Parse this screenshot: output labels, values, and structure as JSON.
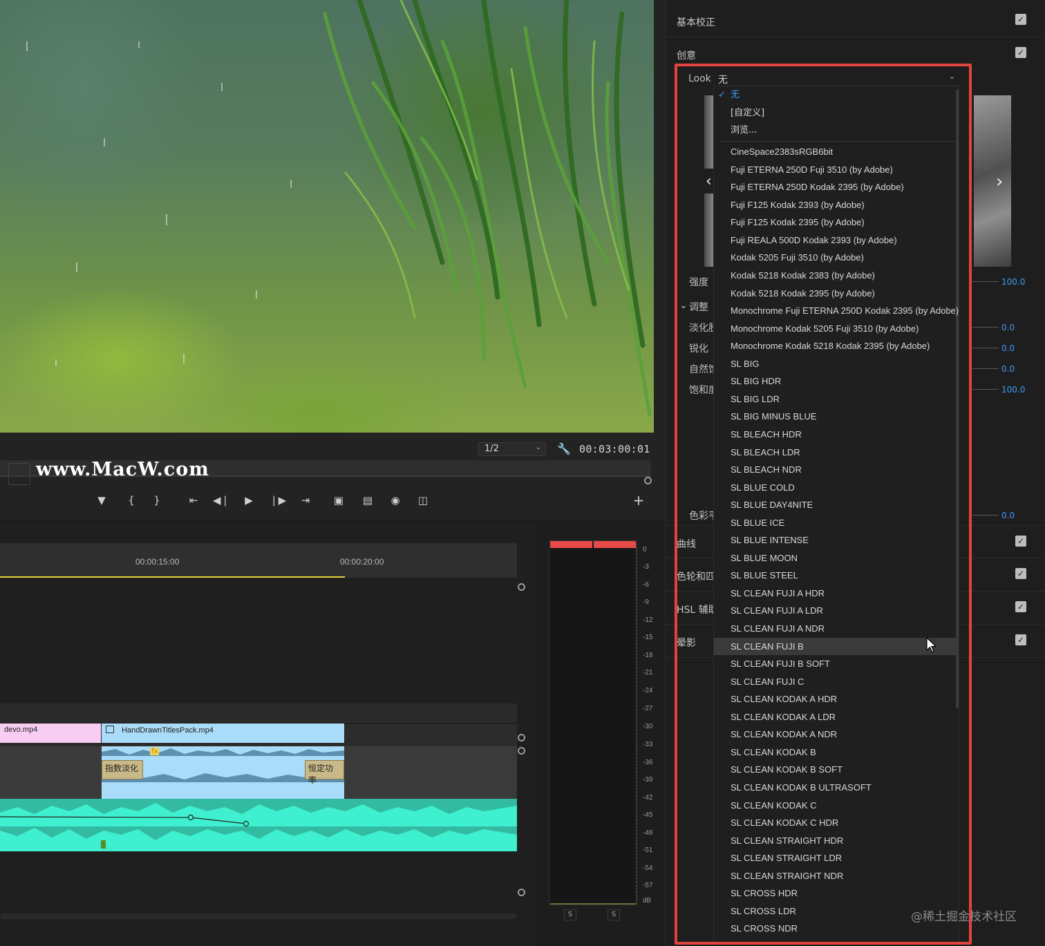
{
  "monitor": {
    "zoom_level": "1/2",
    "timecode": "00:03:00:01",
    "watermark": "www.MacW.com",
    "transport_icons": [
      "add-marker-icon",
      "mark-in-icon",
      "mark-out-icon",
      "go-to-in-icon",
      "step-back-icon",
      "play-icon",
      "step-forward-icon",
      "go-to-out-icon",
      "lift-icon",
      "extract-icon",
      "export-frame-icon",
      "comparison-view-icon"
    ],
    "add_button": "+"
  },
  "timeline": {
    "ruler": [
      "00:00:15:00",
      "00:00:20:00"
    ],
    "clips": {
      "pink_clip": "devo.mp4",
      "titles_clip": "HandDrawnTitlesPack.mp4",
      "fx_badge": "fx",
      "fade_in": "指数淡化",
      "fade_out": "恒定功率"
    }
  },
  "meter": {
    "ticks": [
      "0",
      "-3",
      "-6",
      "-9",
      "-12",
      "-15",
      "-18",
      "-21",
      "-24",
      "-27",
      "-30",
      "-33",
      "-36",
      "-39",
      "-42",
      "-45",
      "-48",
      "-51",
      "-54",
      "-57",
      "dB"
    ],
    "solo_left": "S",
    "solo_right": "S"
  },
  "lumetri": {
    "sections": {
      "basic": "基本校正",
      "creative": "创意",
      "curves": "曲线",
      "color_wheels": "色轮和匹",
      "hsl": "HSL 辅助",
      "vignette": "晕影"
    },
    "params": {
      "intensity": {
        "label": "强度",
        "value": "100.0"
      },
      "adjust": "调整",
      "faded": {
        "label": "淡化胶",
        "value": "0.0"
      },
      "sharpen": {
        "label": "锐化",
        "value": "0.0"
      },
      "vibrance": {
        "label": "自然饱",
        "value": "0.0"
      },
      "saturation": {
        "label": "饱和度",
        "value": "100.0"
      },
      "tint_balance": {
        "label": "色彩平",
        "value": "0.0"
      }
    },
    "look": {
      "label": "Look",
      "selected": "无",
      "special_items": [
        "无",
        "[自定义]",
        "浏览..."
      ],
      "items": [
        "CineSpace2383sRGB6bit",
        "Fuji ETERNA 250D Fuji 3510 (by Adobe)",
        "Fuji ETERNA 250D Kodak 2395 (by Adobe)",
        "Fuji F125 Kodak 2393 (by Adobe)",
        "Fuji F125 Kodak 2395 (by Adobe)",
        "Fuji REALA 500D Kodak 2393 (by Adobe)",
        "Kodak 5205 Fuji 3510 (by Adobe)",
        "Kodak 5218 Kodak 2383 (by Adobe)",
        "Kodak 5218 Kodak 2395 (by Adobe)",
        "Monochrome Fuji ETERNA 250D Kodak 2395 (by Adobe)",
        "Monochrome Kodak 5205 Fuji 3510 (by Adobe)",
        "Monochrome Kodak 5218 Kodak 2395 (by Adobe)",
        "SL BIG",
        "SL BIG HDR",
        "SL BIG LDR",
        "SL BIG MINUS BLUE",
        "SL BLEACH HDR",
        "SL BLEACH LDR",
        "SL BLEACH NDR",
        "SL BLUE COLD",
        "SL BLUE DAY4NITE",
        "SL BLUE ICE",
        "SL BLUE INTENSE",
        "SL BLUE MOON",
        "SL BLUE STEEL",
        "SL CLEAN FUJI A HDR",
        "SL CLEAN FUJI A LDR",
        "SL CLEAN FUJI A NDR",
        "SL CLEAN FUJI B",
        "SL CLEAN FUJI B SOFT",
        "SL CLEAN FUJI C",
        "SL CLEAN KODAK A HDR",
        "SL CLEAN KODAK A LDR",
        "SL CLEAN KODAK A NDR",
        "SL CLEAN KODAK B",
        "SL CLEAN KODAK B SOFT",
        "SL CLEAN KODAK B ULTRASOFT",
        "SL CLEAN KODAK C",
        "SL CLEAN KODAK C HDR",
        "SL CLEAN STRAIGHT HDR",
        "SL CLEAN STRAIGHT LDR",
        "SL CLEAN STRAIGHT NDR",
        "SL CROSS HDR",
        "SL CROSS LDR",
        "SL CROSS NDR"
      ],
      "hovered": "SL CLEAN FUJI B"
    }
  },
  "footer_watermark": "@稀土掘金技术社区",
  "colors": {
    "accent_blue": "#3f9cf5",
    "highlight_red": "#e3433e",
    "audio_teal": "#3ef0cf",
    "clip_pink": "#f7cdf4",
    "clip_blue": "#a9dcf8"
  }
}
